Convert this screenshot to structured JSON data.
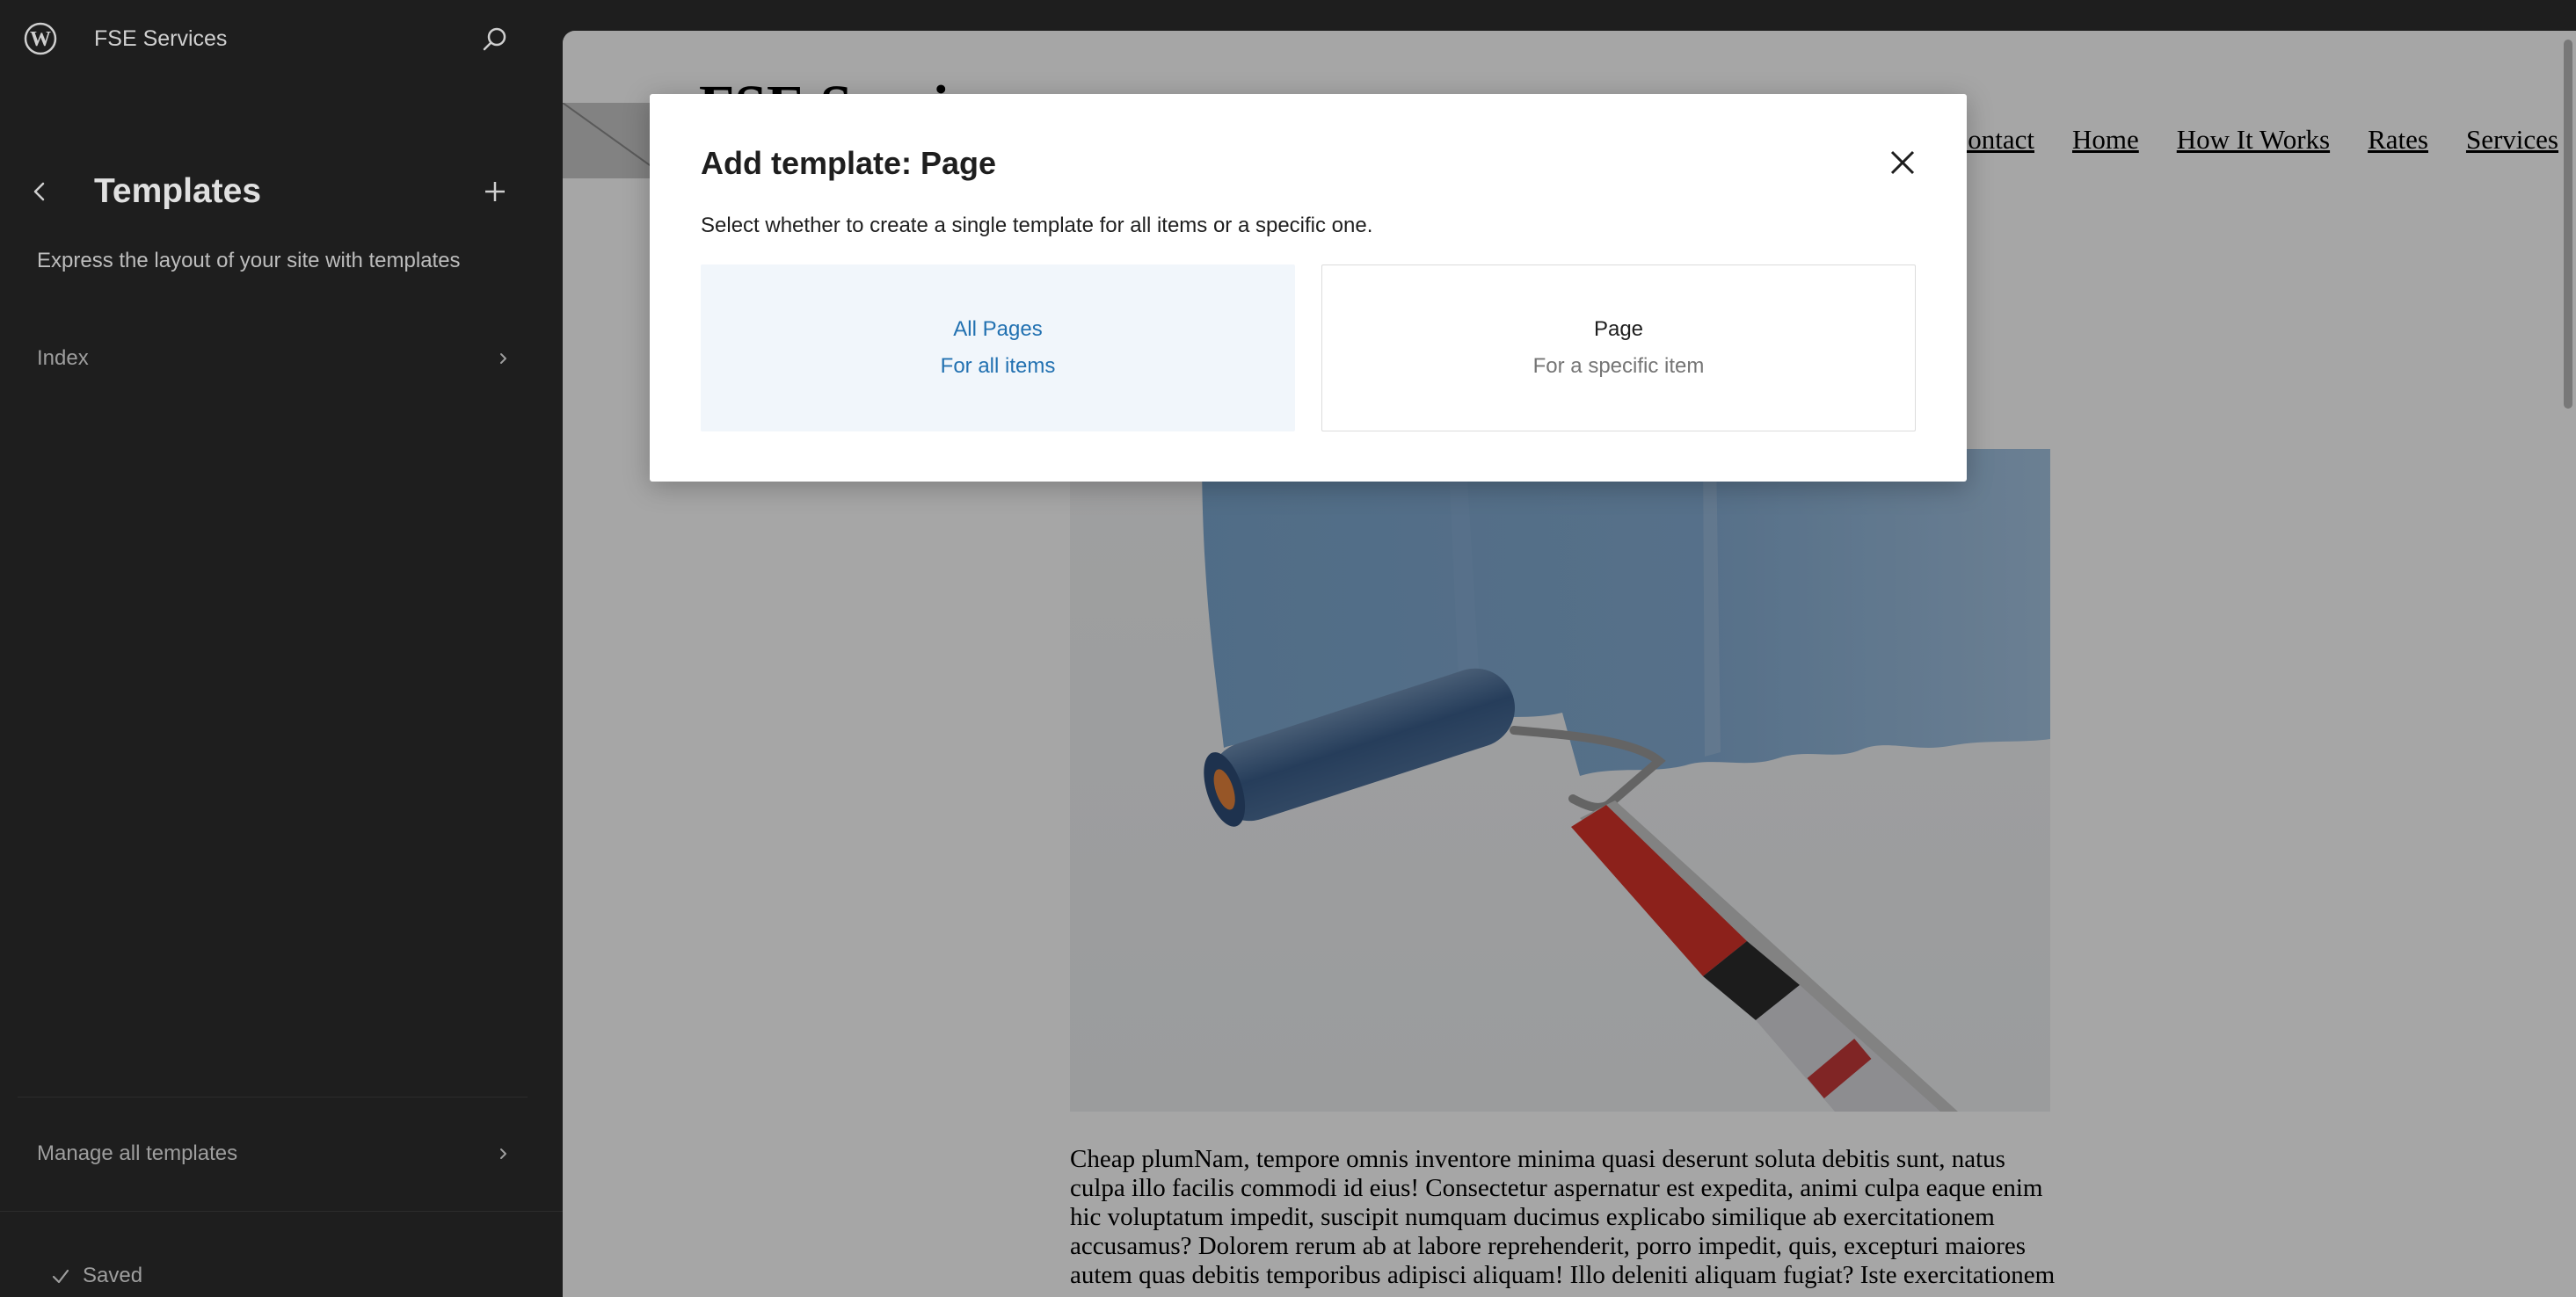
{
  "sidebar": {
    "site_name": "FSE Services",
    "title": "Templates",
    "description": "Express the layout of your site with templates",
    "items": [
      {
        "label": "Index"
      }
    ],
    "manage_label": "Manage all templates",
    "status": "Saved",
    "icons": [
      "wordpress-logo-icon",
      "search-icon",
      "back-arrow-icon",
      "plus-icon",
      "chevron-right-icon",
      "checkmark-icon"
    ]
  },
  "preview": {
    "site_title": "FSE Services",
    "nav": [
      "Contact",
      "Home",
      "How It Works",
      "Rates",
      "Services"
    ],
    "hero_image": "paint-roller-image",
    "body_text": "Cheap plumNam, tempore omnis inventore minima quasi deserunt soluta debitis sunt, natus culpa illo facilis commodi id eius! Consectetur aspernatur est expedita, animi culpa eaque enim hic voluptatum impedit, suscipit numquam ducimus explicabo similique ab exercitationem accusamus? Dolorem rerum ab at labore reprehenderit, porro impedit, quis, excepturi maiores autem quas debitis temporibus adipisci aliquam! Illo deleniti aliquam fugiat? Iste exercitationem"
  },
  "modal": {
    "title": "Add template: Page",
    "description": "Select whether to create a single template for all items or a specific one.",
    "options": [
      {
        "title": "All Pages",
        "subtitle": "For all items"
      },
      {
        "title": "Page",
        "subtitle": "For a specific item"
      }
    ]
  },
  "colors": {
    "sidebar_bg": "#1e1e1e",
    "accent": "#2271b1",
    "selected_option_bg": "#f1f6fb"
  }
}
